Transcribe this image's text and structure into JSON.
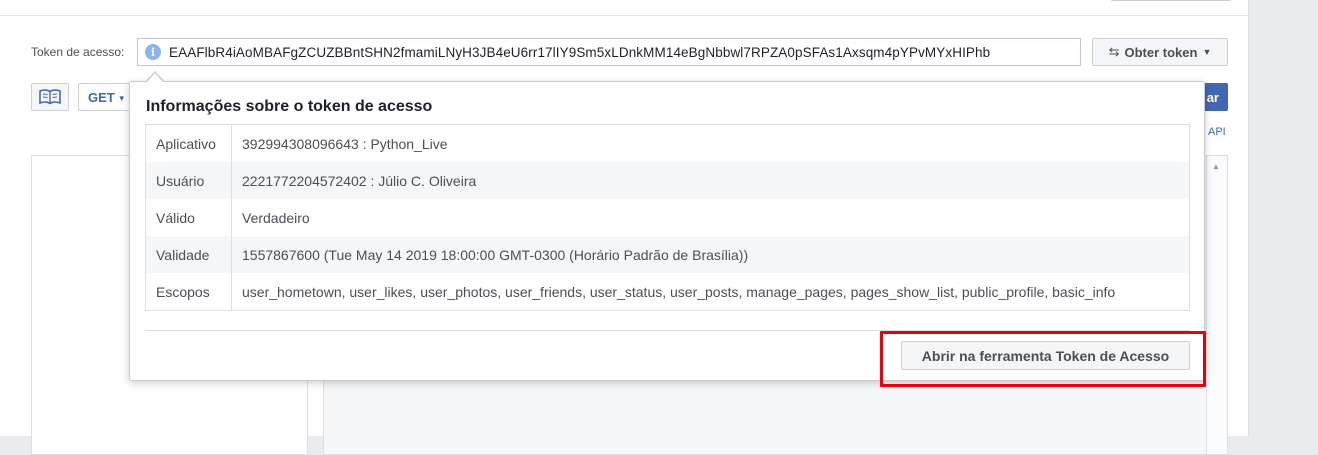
{
  "header": {
    "token_label": "Token de acesso:",
    "token_value": "EAAFlbR4iAoMBAFgZCUZBBntSHN2fmamiLNyH3JB4eU6rr17lIY9Sm5xLDnkMM14eBgNbbwl7RPZA0pSFAs1Axsqm4pYPvMYxHIPhb",
    "get_token_label": "Obter token",
    "method_value": "GET",
    "submit_label": "ar",
    "api_link": "API"
  },
  "popover": {
    "title": "Informações sobre o token de acesso",
    "rows": [
      {
        "key": "Aplicativo",
        "value": "392994308096643 : Python_Live"
      },
      {
        "key": "Usuário",
        "value": "2221772204572402 : Júlio C. Oliveira"
      },
      {
        "key": "Válido",
        "value": "Verdadeiro"
      },
      {
        "key": "Validade",
        "value": "1557867600 (Tue May 14 2019 18:00:00 GMT-0300 (Horário Padrão de Brasília))"
      },
      {
        "key": "Escopos",
        "value": "user_hometown, user_likes, user_photos, user_friends, user_status, user_posts, manage_pages, pages_show_list, public_profile, basic_info"
      }
    ],
    "open_tool_label": "Abrir na ferramenta Token de Acesso"
  },
  "colors": {
    "accent": "#4267b2",
    "highlight": "#e8000b",
    "info_icon": "#8ab4f0"
  },
  "icons": {
    "info": "info-icon",
    "book": "book-icon",
    "swap": "swap-icon"
  }
}
